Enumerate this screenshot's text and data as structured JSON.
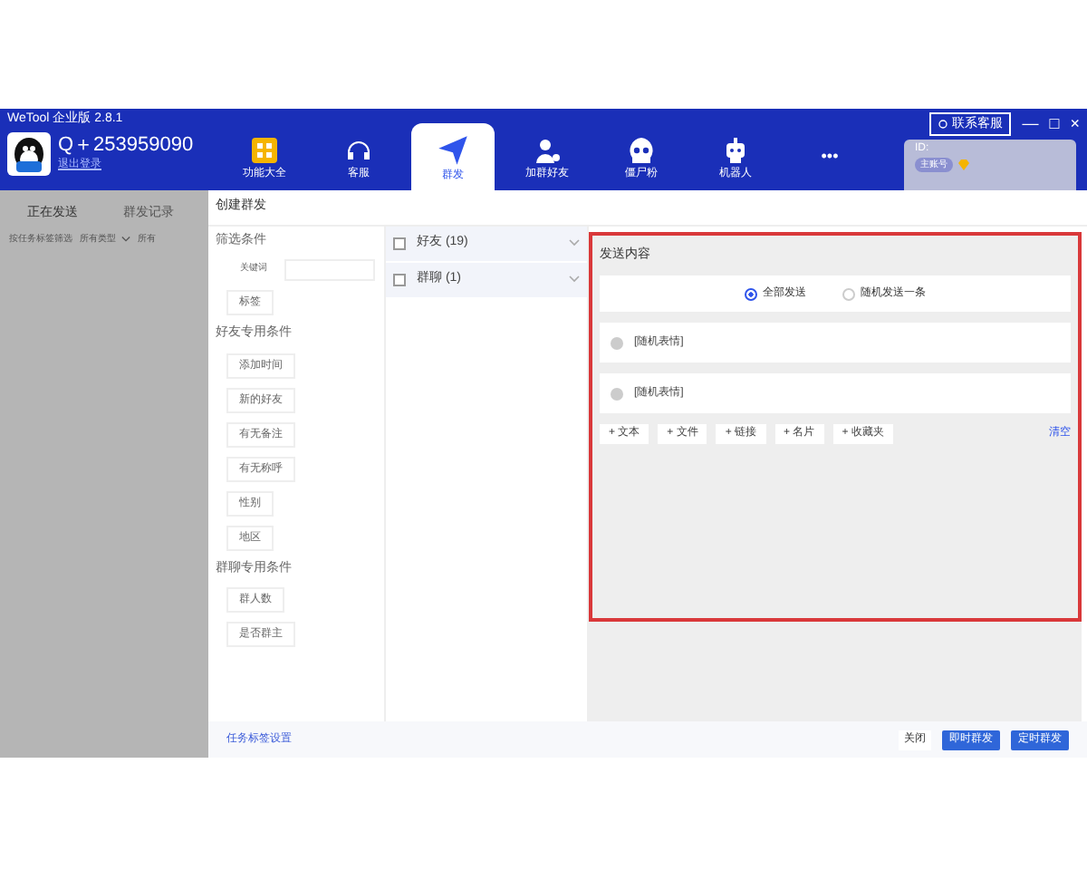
{
  "window": {
    "title": "WeTool 企业版 2.8.1",
    "controls": [
      "—",
      "□",
      "×"
    ]
  },
  "account": {
    "name": "Q＋253959090",
    "logout": "退出登录",
    "id_label": "ID:",
    "badge": "主账号"
  },
  "nav": [
    {
      "label": "功能大全",
      "kind": "grid",
      "selected": false
    },
    {
      "label": "客服",
      "kind": "headset",
      "selected": false
    },
    {
      "label": "群发",
      "kind": "send",
      "selected": true
    },
    {
      "label": "加群好友",
      "kind": "user",
      "selected": false
    },
    {
      "label": "僵尸粉",
      "kind": "skull",
      "selected": false
    },
    {
      "label": "机器人",
      "kind": "robot",
      "selected": false
    },
    {
      "label": "•••",
      "kind": "more",
      "selected": false
    }
  ],
  "contact_button": "联系客服",
  "left_panel": {
    "tabs": [
      {
        "label": "正在发送",
        "selected": true
      },
      {
        "label": "群发记录",
        "selected": false
      }
    ],
    "filter_label": "按任务标签筛选",
    "type_select": "所有类型",
    "select_cut": "所有"
  },
  "drawer": {
    "title": "创建群发",
    "filters": {
      "heading": "筛选条件",
      "keyword_label": "关键词",
      "tag": "标签",
      "friend_heading": "好友专用条件",
      "friend_items": [
        "添加时间",
        "新的好友",
        "有无备注",
        "有无称呼",
        "性别",
        "地区"
      ],
      "group_heading": "群聊专用条件",
      "group_items": [
        "群人数",
        "是否群主"
      ]
    },
    "targets": [
      {
        "label": "好友 (19)",
        "checked": false
      },
      {
        "label": "群聊 (1)",
        "checked": false
      }
    ],
    "content": {
      "heading": "发送内容",
      "modes": [
        {
          "label": "全部发送",
          "selected": true
        },
        {
          "label": "随机发送一条",
          "selected": false
        }
      ],
      "messages": [
        "[随机表情]",
        "[随机表情]"
      ],
      "add_buttons": [
        "+ 文本",
        "+ 文件",
        "+ 链接",
        "+ 名片",
        "+ 收藏夹"
      ],
      "clear": "清空"
    },
    "footer": {
      "link": "任务标签设置",
      "close": "关闭",
      "send_now": "即时群发",
      "schedule": "定时群发"
    }
  }
}
